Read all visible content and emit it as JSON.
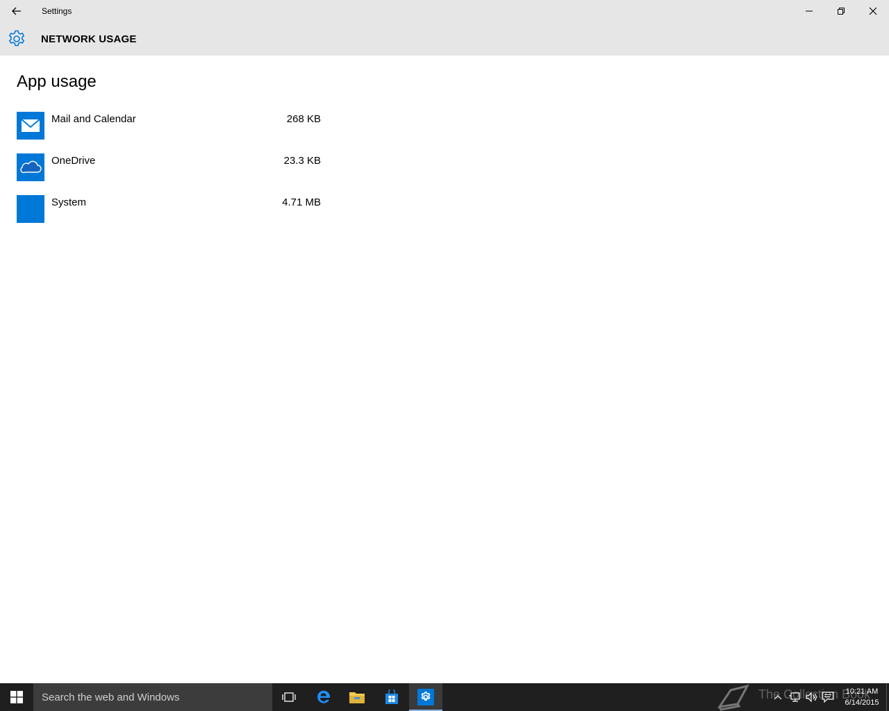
{
  "window": {
    "title": "Settings",
    "controls": [
      "minimize",
      "restore",
      "close"
    ]
  },
  "header": {
    "title": "NETWORK USAGE",
    "icon": "gear-icon"
  },
  "content": {
    "section_title": "App usage",
    "apps": [
      {
        "name": "Mail and Calendar",
        "usage": "268 KB",
        "icon": "mail-icon"
      },
      {
        "name": "OneDrive",
        "usage": "23.3 KB",
        "icon": "onedrive-cloud-icon"
      },
      {
        "name": "System",
        "usage": "4.71 MB",
        "icon": "system-tile"
      }
    ]
  },
  "taskbar": {
    "search_placeholder": "Search the web and Windows",
    "pinned": [
      "task-view-icon",
      "edge-icon",
      "file-explorer-icon",
      "store-icon",
      "settings-icon"
    ],
    "active_app": "settings-icon",
    "watermark": "The Collection Book",
    "clock": {
      "time": "10:21 AM",
      "date": "6/14/2015"
    }
  },
  "colors": {
    "accent": "#0078d7",
    "header_bg": "#e6e6e6",
    "taskbar_bg": "#1f1f1f",
    "search_bg": "#3c3c3c"
  }
}
